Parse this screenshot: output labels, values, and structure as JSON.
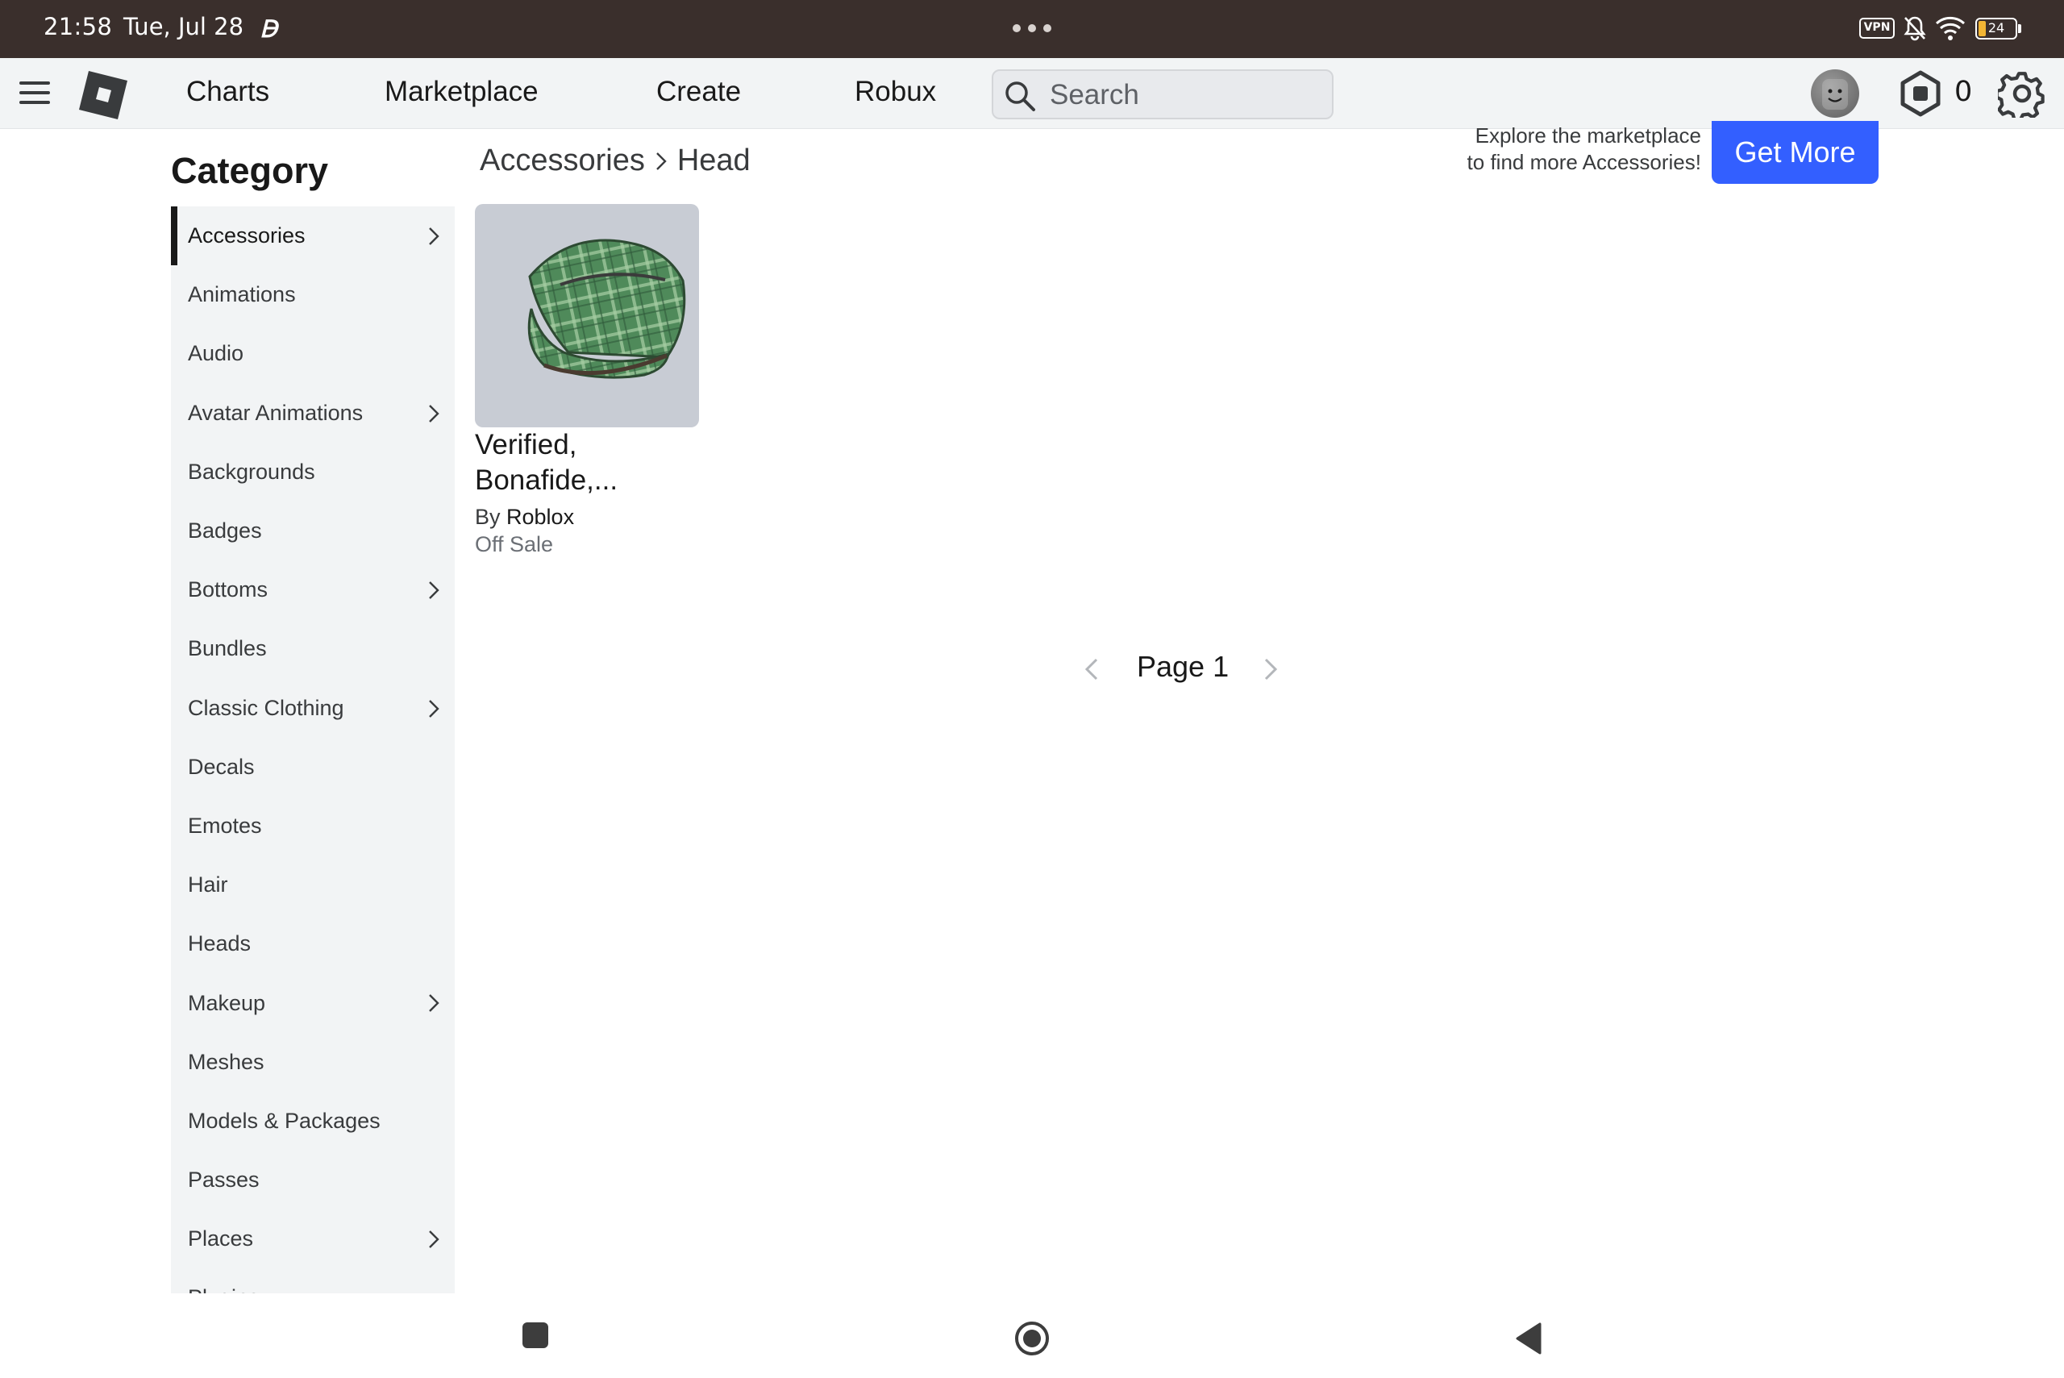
{
  "status_bar": {
    "time": "21:58",
    "date": "Tue, Jul 28",
    "vpn_label": "VPN",
    "battery_level": "24"
  },
  "nav": {
    "links": [
      "Charts",
      "Marketplace",
      "Create",
      "Robux"
    ],
    "search_placeholder": "Search",
    "robux_count": "0"
  },
  "sidebar": {
    "title": "Category",
    "items": [
      {
        "label": "Accessories",
        "has_children": true,
        "active": true
      },
      {
        "label": "Animations",
        "has_children": false
      },
      {
        "label": "Audio",
        "has_children": false
      },
      {
        "label": "Avatar Animations",
        "has_children": true
      },
      {
        "label": "Backgrounds",
        "has_children": false
      },
      {
        "label": "Badges",
        "has_children": false
      },
      {
        "label": "Bottoms",
        "has_children": true
      },
      {
        "label": "Bundles",
        "has_children": false
      },
      {
        "label": "Classic Clothing",
        "has_children": true
      },
      {
        "label": "Decals",
        "has_children": false
      },
      {
        "label": "Emotes",
        "has_children": false
      },
      {
        "label": "Hair",
        "has_children": false
      },
      {
        "label": "Heads",
        "has_children": false
      },
      {
        "label": "Makeup",
        "has_children": true
      },
      {
        "label": "Meshes",
        "has_children": false
      },
      {
        "label": "Models & Packages",
        "has_children": false
      },
      {
        "label": "Passes",
        "has_children": false
      },
      {
        "label": "Places",
        "has_children": true
      },
      {
        "label": "Plugins",
        "has_children": false
      }
    ]
  },
  "breadcrumb": {
    "parent": "Accessories",
    "current": "Head"
  },
  "promo": {
    "line1": "Explore the marketplace",
    "line2": "to find more Accessories!",
    "button": "Get More"
  },
  "item": {
    "name_line1": "Verified,",
    "name_line2": "Bonafide,...",
    "creator_prefix": "By",
    "creator": "Roblox",
    "status": "Off Sale"
  },
  "pager": {
    "label": "Page 1"
  },
  "colors": {
    "status_bar_bg": "#3a2f2c",
    "nav_bg": "#f2f4f5",
    "accent_blue": "#335fff",
    "hat_green": "#4f8a5a"
  }
}
